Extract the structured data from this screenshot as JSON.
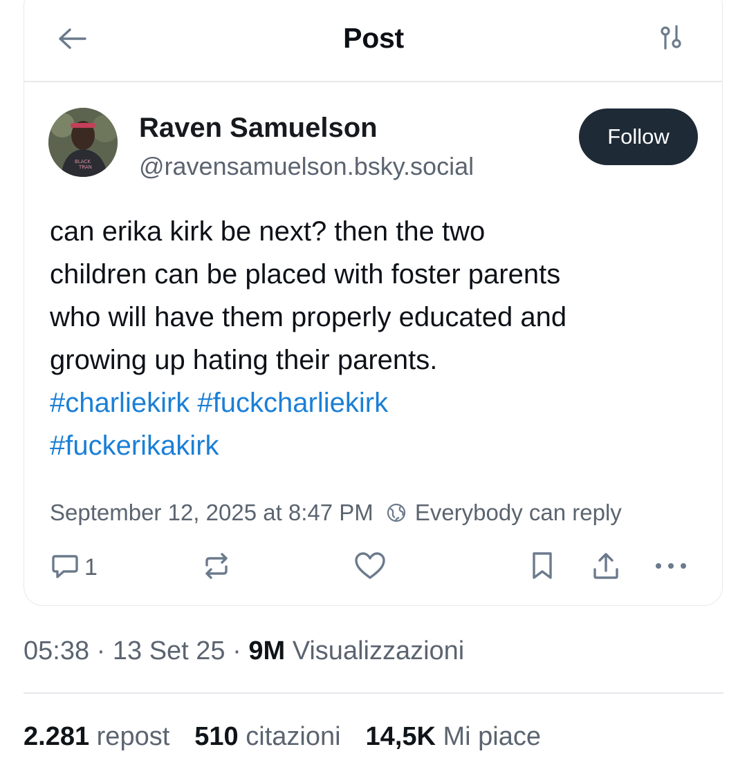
{
  "header": {
    "title": "Post"
  },
  "author": {
    "name": "Raven Samuelson",
    "handle": "@ravensamuelson.bsky.social",
    "follow_label": "Follow"
  },
  "post": {
    "lines": [
      "can erika kirk be next? then the two",
      "children can be placed with foster parents",
      "who will have them properly educated and",
      "growing up hating their parents."
    ],
    "hashtags_line1": [
      "#charliekirk",
      "#fuckcharliekirk"
    ],
    "hashtags_line2": [
      "#fuckerikakirk"
    ],
    "timestamp": "September 12, 2025 at 8:47 PM",
    "reply_setting": "Everybody can reply"
  },
  "actions": {
    "reply_count": "1"
  },
  "footer": {
    "time": "05:38",
    "date": "13 Set 25",
    "views_count": "9M",
    "views_label": "Visualizzazioni"
  },
  "stats": {
    "reposts_count": "2.281",
    "reposts_label": "repost",
    "quotes_count": "510",
    "quotes_label": "citazioni",
    "likes_count": "14,5K",
    "likes_label": "Mi piace"
  },
  "colors": {
    "hashtag": "#1a7fd6",
    "follow_bg": "#1f2a37",
    "muted_text": "#5b6470",
    "icon": "#6b7a8c"
  },
  "icons": {
    "back": "arrow-left-icon",
    "filter": "sliders-icon",
    "globe": "globe-icon",
    "reply": "speech-bubble-icon",
    "repost": "repost-icon",
    "like": "heart-icon",
    "bookmark": "bookmark-icon",
    "share": "share-icon",
    "more": "more-icon"
  }
}
